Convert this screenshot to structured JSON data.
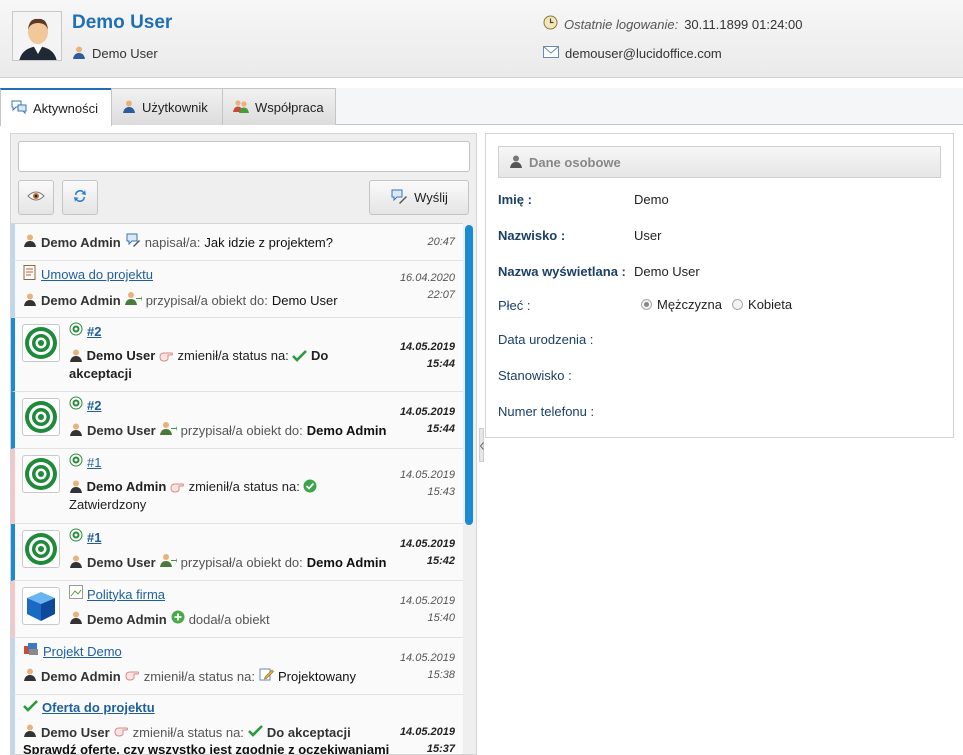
{
  "header": {
    "user_name": "Demo User",
    "user_sub": "Demo User",
    "last_login_label": "Ostatnie logowanie:",
    "last_login_value": "30.11.1899 01:24:00",
    "email": "demouser@lucidoffice.com"
  },
  "tabs": [
    {
      "label": "Aktywności",
      "active": true
    },
    {
      "label": "Użytkownik",
      "active": false
    },
    {
      "label": "Współpraca",
      "active": false
    }
  ],
  "composer": {
    "placeholder": "",
    "send_label": "Wyślij"
  },
  "feed": {
    "items": [
      {
        "author": "Demo Admin",
        "action": "napisał/a:",
        "object": "Jak idzie z projektem?",
        "time": "20:47"
      },
      {
        "link": "Umowa do projektu",
        "author": "Demo Admin",
        "action": "przypisał/a obiekt do:",
        "object": "Demo User",
        "date": "16.04.2020",
        "time": "22:07"
      },
      {
        "link": "#2",
        "author": "Demo User",
        "action": "zmienił/a status na:",
        "object": "Do akceptacji",
        "date": "14.05.2019",
        "time": "15:44"
      },
      {
        "link": "#2",
        "author": "Demo User",
        "action": "przypisał/a obiekt do:",
        "object": "Demo Admin",
        "date": "14.05.2019",
        "time": "15:44"
      },
      {
        "link": "#1",
        "author": "Demo Admin",
        "action": "zmienił/a status na:",
        "object": "Zatwierdzony",
        "date": "14.05.2019",
        "time": "15:43"
      },
      {
        "link": "#1",
        "author": "Demo User",
        "action": "przypisał/a obiekt do:",
        "object": "Demo Admin",
        "date": "14.05.2019",
        "time": "15:42"
      },
      {
        "link": "Polityka firma",
        "author": "Demo Admin",
        "action": "dodał/a obiekt",
        "date": "14.05.2019",
        "time": "15:40"
      },
      {
        "link": "Projekt Demo",
        "author": "Demo Admin",
        "action": "zmienił/a status na:",
        "object": "Projektowany",
        "date": "14.05.2019",
        "time": "15:38"
      },
      {
        "link": "Oferta do projektu",
        "author": "Demo User",
        "action": "zmienił/a status na:",
        "object": "Do akceptacji",
        "note": "Sprawdź ofertę, czy wszystko jest zgodnie z oczekiwaniami",
        "date": "14.05.2019",
        "time": "15:37"
      }
    ]
  },
  "personal": {
    "section_title": "Dane osobowe",
    "first_name_label": "Imię :",
    "first_name": "Demo",
    "last_name_label": "Nazwisko :",
    "last_name": "User",
    "display_name_label": "Nazwa wyświetlana :",
    "display_name": "Demo User",
    "gender_label": "Płeć :",
    "gender_male": "Mężczyzna",
    "gender_female": "Kobieta",
    "gender_selected": "Mężczyzna",
    "birth_label": "Data urodzenia :",
    "position_label": "Stanowisko :",
    "phone_label": "Numer telefonu :"
  },
  "colors": {
    "accent": "#1f6eb6",
    "scrollbar": "#1a8ad4",
    "label": "#1b3f66"
  }
}
